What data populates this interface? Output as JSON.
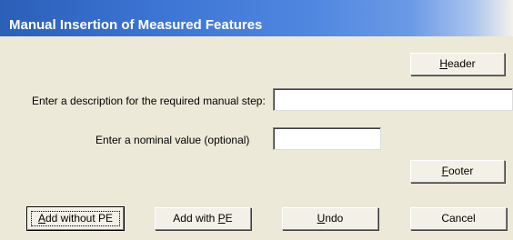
{
  "window": {
    "title": "Manual Insertion of Measured Features"
  },
  "buttons": {
    "header": {
      "label": "Header",
      "mnemonic": "H"
    },
    "footer": {
      "label": "Footer",
      "mnemonic": "F"
    },
    "add_without_pe": {
      "label": "Add without PE",
      "mnemonic": "A"
    },
    "add_with_pe": {
      "label": "Add with PE",
      "mnemonic": "P"
    },
    "undo": {
      "label": "Undo",
      "mnemonic": "U"
    },
    "cancel": {
      "label": "Cancel"
    }
  },
  "form": {
    "description_label": "Enter a description for the required manual step:",
    "description_value": "",
    "nominal_label": "Enter a nominal value (optional)",
    "nominal_value": ""
  }
}
